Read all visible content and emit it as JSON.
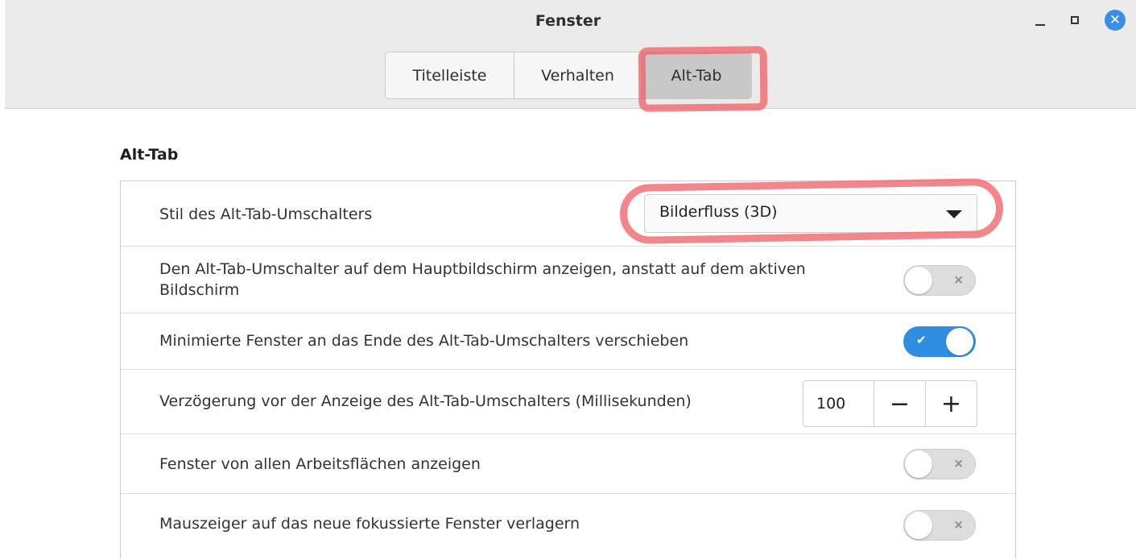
{
  "window": {
    "title": "Fenster",
    "controls": {
      "minimize": "minimize-icon",
      "maximize": "maximize-icon",
      "close": "close-icon"
    }
  },
  "tabs": [
    {
      "label": "Titelleiste",
      "active": false
    },
    {
      "label": "Verhalten",
      "active": false
    },
    {
      "label": "Alt-Tab",
      "active": true
    }
  ],
  "section": {
    "heading": "Alt-Tab",
    "rows": [
      {
        "label": "Stil des Alt-Tab-Umschalters",
        "control": "dropdown",
        "value": "Bilderfluss (3D)"
      },
      {
        "label": "Den Alt-Tab-Umschalter auf dem Hauptbildschirm anzeigen, anstatt auf dem aktiven Bildschirm",
        "control": "toggle",
        "value": false,
        "mark": "×"
      },
      {
        "label": "Minimierte Fenster an das Ende des Alt-Tab-Umschalters verschieben",
        "control": "toggle",
        "value": true,
        "mark": "✔"
      },
      {
        "label": "Verzögerung vor der Anzeige des Alt-Tab-Umschalters (Millisekunden)",
        "control": "spinbutton",
        "value": "100",
        "minus": "−",
        "plus": "+"
      },
      {
        "label": "Fenster von allen Arbeitsflächen anzeigen",
        "control": "toggle",
        "value": false,
        "mark": "×"
      },
      {
        "label": "Mauszeiger auf das neue fokussierte Fenster verlagern",
        "control": "toggle",
        "value": false,
        "mark": "×"
      }
    ]
  },
  "colors": {
    "accent": "#2f8ee2",
    "close_button": "#3b8ee6",
    "highlight_annotation": "#f06469",
    "headerbar": "#ebebeb"
  }
}
